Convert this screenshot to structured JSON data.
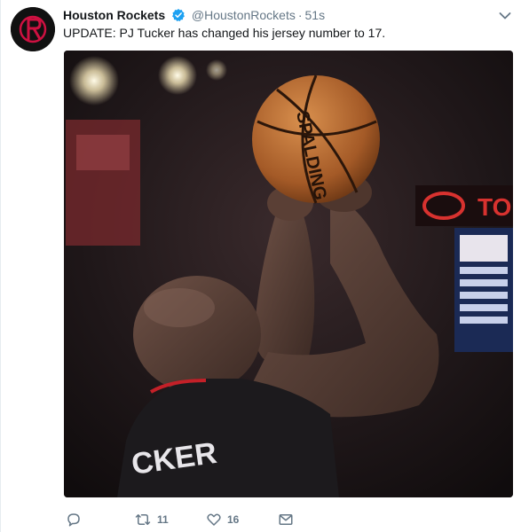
{
  "tweet": {
    "account_name": "Houston Rockets",
    "handle": "@HoustonRockets",
    "separator": "·",
    "timestamp": "51s",
    "text": "UPDATE: PJ Tucker has changed his jersey number to 17."
  },
  "media": {
    "ball_text": "SPALDING",
    "jersey_text": "CKER",
    "sign_text": "TO"
  },
  "actions": {
    "retweets": "11",
    "likes": "16"
  },
  "icons": {
    "verified": "verified-badge-icon",
    "caret": "chevron-down-icon",
    "reply": "reply-icon",
    "retweet": "retweet-icon",
    "like": "heart-icon",
    "message": "envelope-icon"
  },
  "colors": {
    "brand_red": "#ce1141",
    "verified_blue": "#1da1f2",
    "muted": "#657786"
  }
}
